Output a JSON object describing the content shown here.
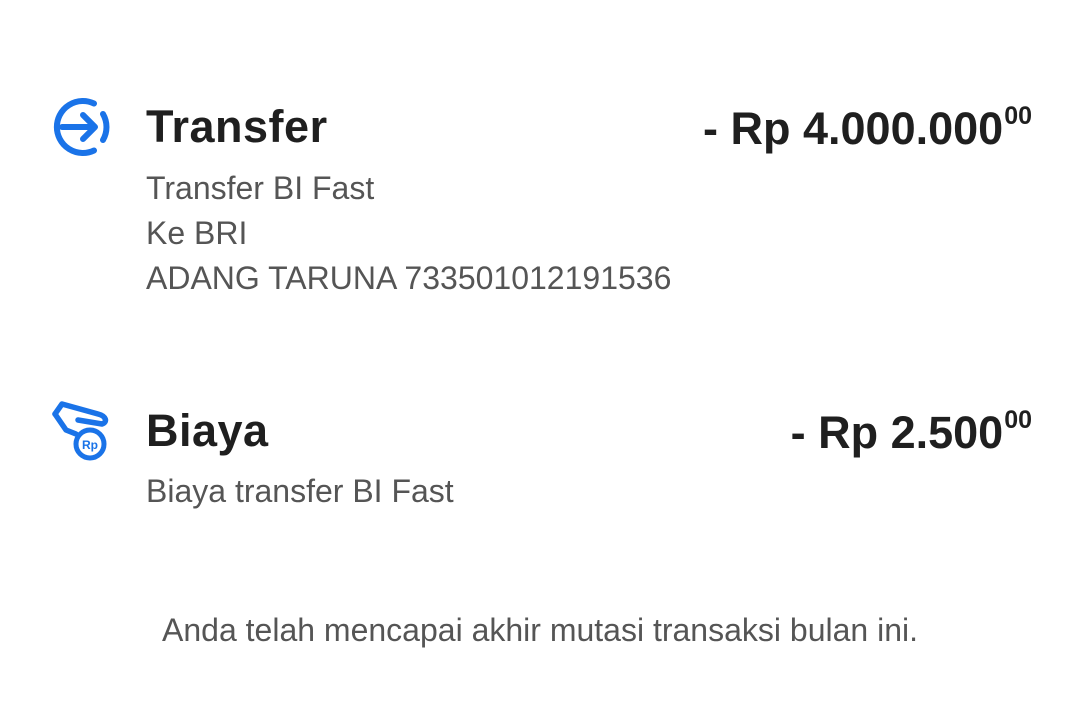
{
  "accent_color": "#1a73e8",
  "transactions": [
    {
      "icon": "transfer-arrow-icon",
      "title": "Transfer",
      "amount": "- Rp 4.000.000",
      "amount_cents": "00",
      "details": [
        "Transfer BI Fast",
        "Ke BRI",
        "ADANG TARUNA 733501012191536"
      ]
    },
    {
      "icon": "fee-hand-rp-icon",
      "title": "Biaya",
      "amount": "- Rp 2.500",
      "amount_cents": "00",
      "details": [
        "Biaya transfer BI Fast"
      ]
    }
  ],
  "footer_text": "Anda telah mencapai akhir mutasi transaksi bulan ini."
}
